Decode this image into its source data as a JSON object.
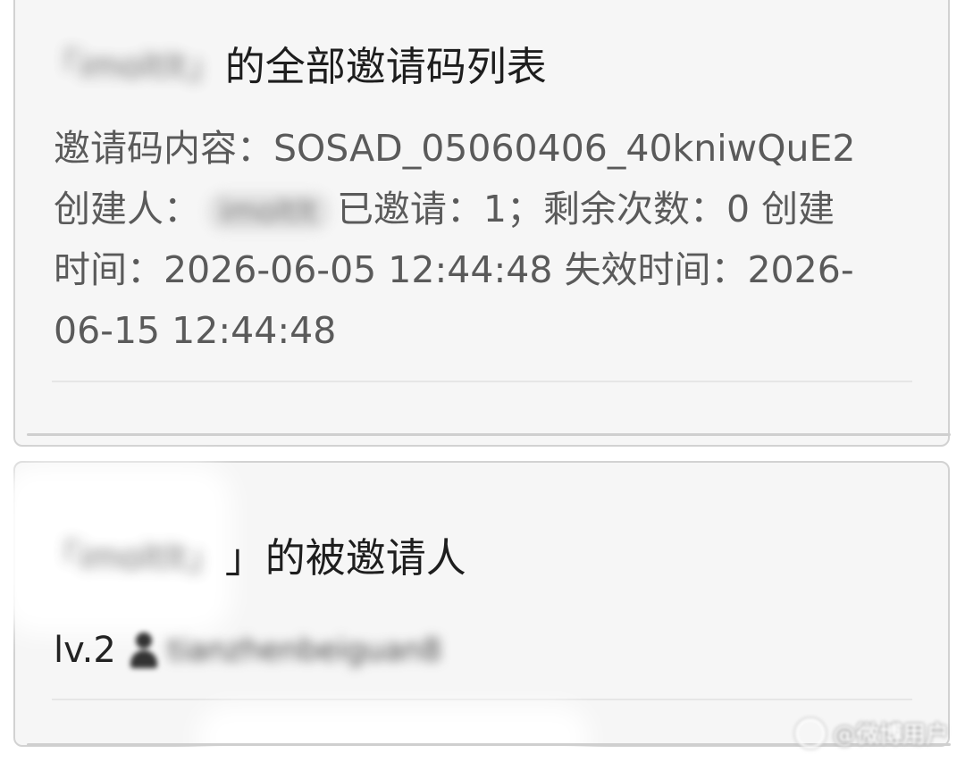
{
  "invite_codes_card": {
    "owner_name": "「imoltlt」",
    "title_suffix": "的全部邀请码列表",
    "code_label": "邀请码内容：",
    "code_value": "SOSAD_05060406_40kniwQuE2",
    "creator_label": "创建人：",
    "creator_name": "imoltlt",
    "invited_text": "已邀请：1；剩余次数：0 创建",
    "created_time_line": "时间：2026-06-05 12:44:48 失效时间：2026-",
    "expire_time_tail": "06-15 12:44:48"
  },
  "invitees_card": {
    "owner_name": "「imoltlt」",
    "title_suffix": "」的被邀请人",
    "invitees": [
      {
        "level": "lv.2",
        "icon": "user-icon",
        "username": "tianzhenbeiguan8"
      }
    ]
  },
  "watermark": {
    "text": "@微博用户"
  }
}
